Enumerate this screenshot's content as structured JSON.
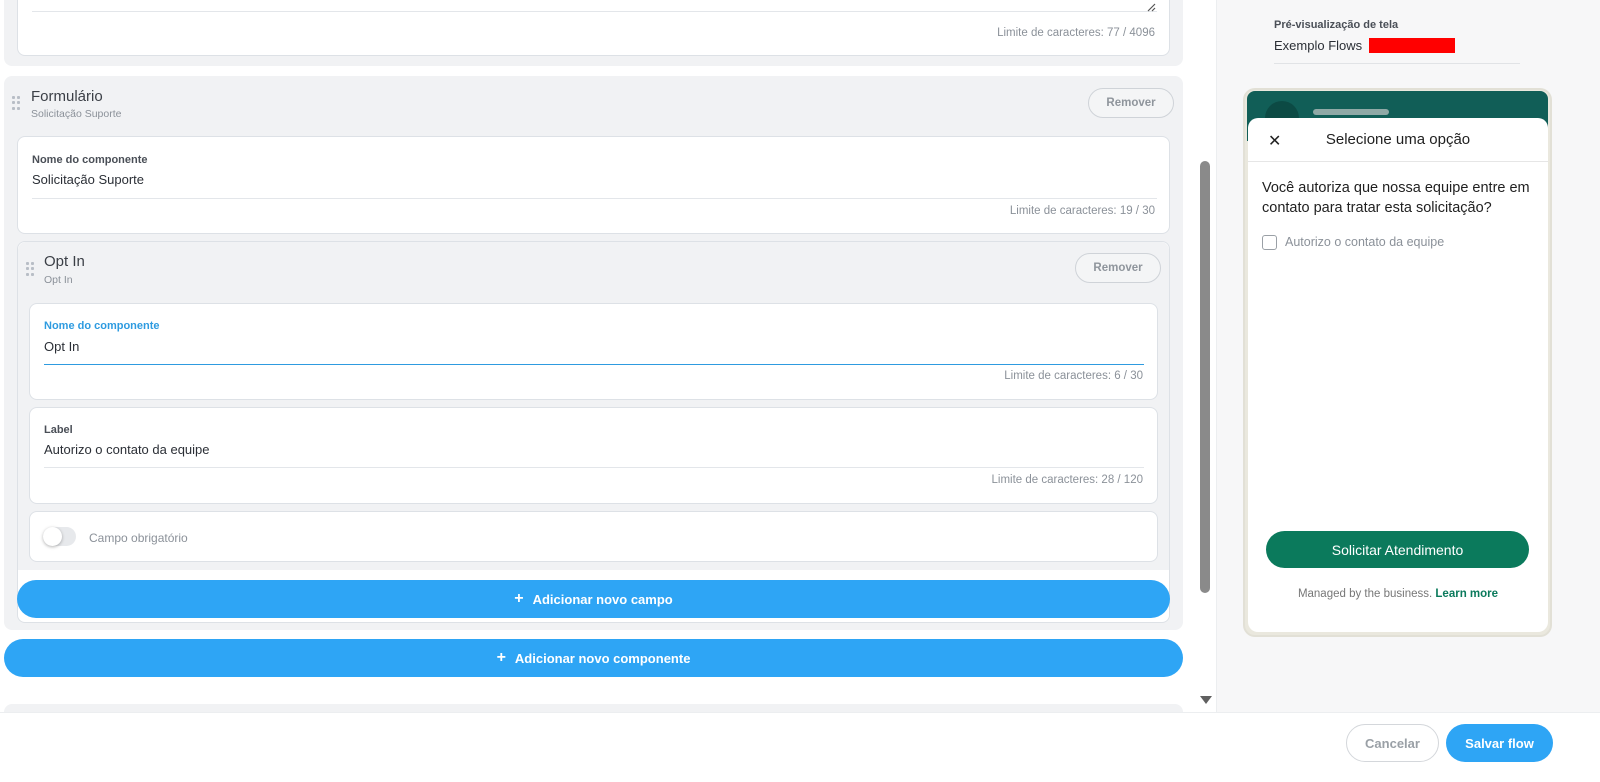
{
  "top_card": {
    "limit_text": "Limite de caracteres: 77 / 4096"
  },
  "form_section": {
    "title": "Formulário",
    "subtitle": "Solicitação Suporte",
    "remove_label": "Remover",
    "name_field": {
      "label": "Nome do componente",
      "value": "Solicitação Suporte",
      "limit_text": "Limite de caracteres: 19 / 30"
    },
    "opt_in": {
      "title": "Opt In",
      "subtitle": "Opt In",
      "remove_label": "Remover",
      "name_field": {
        "label": "Nome do componente",
        "value": "Opt In",
        "limit_text": "Limite de caracteres: 6 / 30"
      },
      "label_field": {
        "label": "Label",
        "value": "Autorizo o contato da equipe",
        "limit_text": "Limite de caracteres: 28 / 120"
      },
      "required_toggle": {
        "label": "Campo obrigatório",
        "enabled": false
      }
    },
    "add_field_label": "Adicionar novo campo"
  },
  "add_component_label": "Adicionar novo componente",
  "preview": {
    "caption": "Pré-visualização de tela",
    "flow_name": "Exemplo Flows",
    "sheet_title": "Selecione uma opção",
    "question": "Você autoriza que nossa equipe entre em contato para tratar esta solicitação?",
    "checkbox_label": "Autorizo o contato da equipe",
    "cta_label": "Solicitar Atendimento",
    "managed_text": "Managed by the business.",
    "learn_more": "Learn more",
    "colors": {
      "header": "#115e57",
      "cta": "#0b7a5c",
      "redaction": "#ff0000"
    }
  },
  "footer": {
    "cancel_label": "Cancelar",
    "save_label": "Salvar flow"
  },
  "colors": {
    "accent_blue": "#2ea5f5"
  }
}
